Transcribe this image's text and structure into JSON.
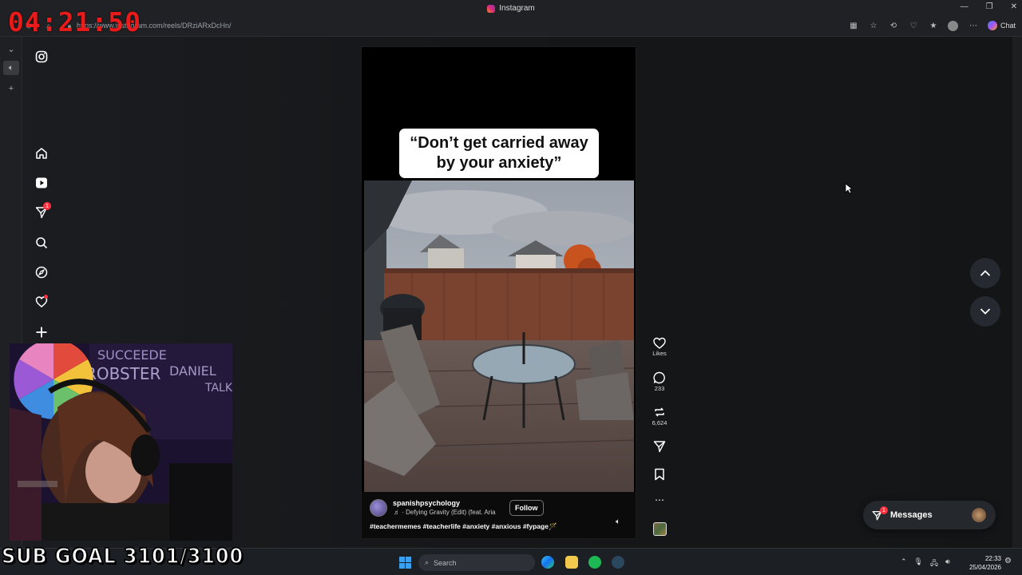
{
  "window": {
    "title": "Instagram",
    "controls": [
      "—",
      "❐",
      "✕"
    ]
  },
  "browser": {
    "url": "https://www.instagram.com/reels/DRziARxDcHn/",
    "chat_label": "Chat"
  },
  "stream_overlay": {
    "timer": "04:21:50",
    "sub_goal": "SUB GOAL 3101/3100"
  },
  "nav": {
    "notifications_badge": "1"
  },
  "reel": {
    "caption": "“Don’t get carried away by your anxiety”",
    "username": "spanishpsychology",
    "audio": "Defying Gravity (Edit) (feat. Aria",
    "follow_label": "Follow",
    "hashtags": "#teachermemes #teacherlife #anxiety #anxious #fypage🪄"
  },
  "actions": {
    "likes_label": "Likes",
    "comments": "233",
    "reposts": "6,624"
  },
  "messages": {
    "label": "Messages",
    "badge": "1"
  },
  "taskbar": {
    "search_placeholder": "Search",
    "time": "22:33",
    "date": "25/04/2026"
  },
  "colors": {
    "accent_red": "#ff3040",
    "timer_red": "#ff1a1a",
    "background": "#151719"
  }
}
